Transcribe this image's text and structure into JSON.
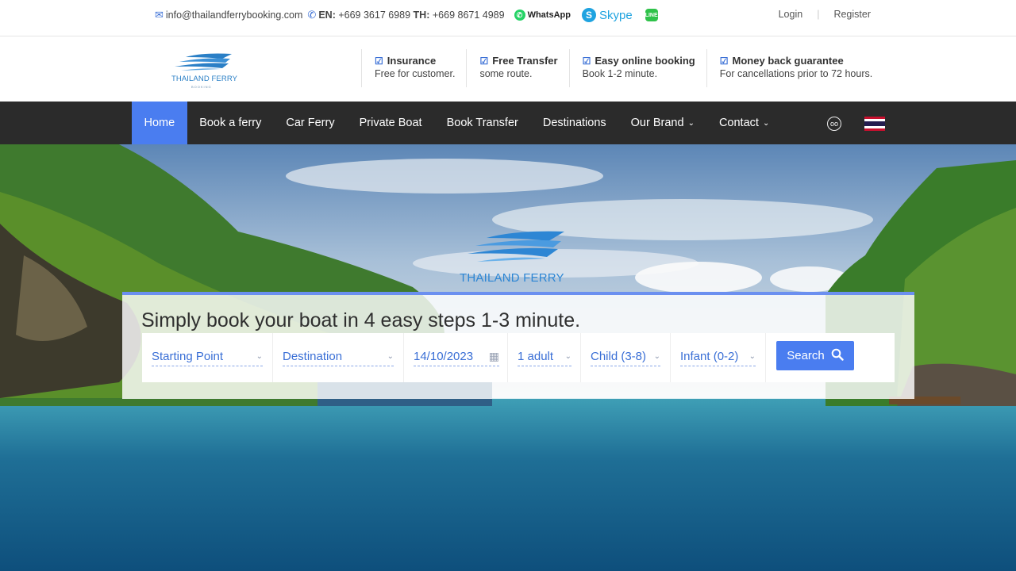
{
  "topbar": {
    "email": "info@thailandferrybooking.com",
    "en_label": "EN:",
    "en_phone": "+669 3617 6989",
    "th_label": "TH:",
    "th_phone": "+669 8671 4989",
    "whatsapp": "WhatsApp",
    "skype": "Skype",
    "line": "LINE",
    "login": "Login",
    "register": "Register"
  },
  "header": {
    "logo_text": "THAILAND FERRY",
    "logo_sub": "BOOKING",
    "features": [
      {
        "title": "Insurance",
        "desc": "Free for customer."
      },
      {
        "title": "Free Transfer",
        "desc": "some route."
      },
      {
        "title": "Easy online booking",
        "desc": "Book 1-2 minute."
      },
      {
        "title": "Money back guarantee",
        "desc": "For cancellations prior to 72 hours."
      }
    ]
  },
  "nav": {
    "items": [
      "Home",
      "Book a ferry",
      "Car Ferry",
      "Private Boat",
      "Book Transfer",
      "Destinations",
      "Our Brand",
      "Contact"
    ],
    "active": "Home"
  },
  "hero": {
    "logo_text": "THAILAND FERRY"
  },
  "booking": {
    "headline": "Simply book your boat in 4 easy steps 1-3 minute.",
    "starting_point": "Starting Point",
    "destination": "Destination",
    "date": "14/10/2023",
    "adults": "1 adult",
    "child": "Child (3-8)",
    "infant": "Infant (0-2)",
    "search_label": "Search"
  },
  "colors": {
    "accent": "#4a7df0",
    "nav_bg": "#2b2b2b",
    "link": "#3a6fd6"
  },
  "icons": [
    "envelope-icon",
    "phone-icon",
    "whatsapp-icon",
    "skype-icon",
    "line-icon",
    "check-icon",
    "tripadvisor-icon",
    "thai-flag-icon",
    "chevron-down-icon",
    "calendar-icon",
    "search-icon"
  ]
}
